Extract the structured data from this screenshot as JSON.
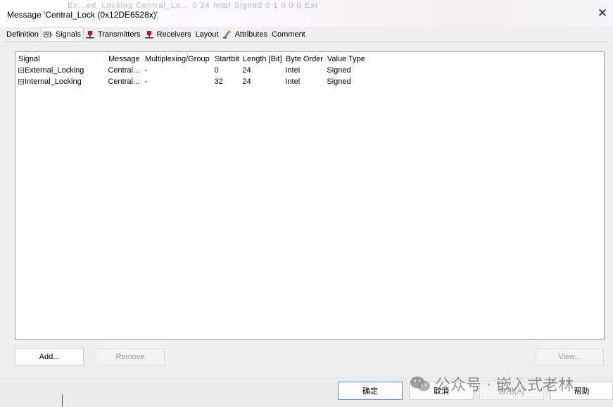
{
  "window": {
    "title": "Message 'Central_Lock (0x12DE6528x)'",
    "background_hint": "Ex...ed_Locking   Central_Lo...   0   24   Intel   Signed   0   1   0   0   0   Ext"
  },
  "tabs": [
    {
      "label": "Definition",
      "icon": "",
      "active": false
    },
    {
      "label": "Signals",
      "icon": "signal-icon",
      "active": true
    },
    {
      "label": "Transmitters",
      "icon": "transmitter-icon",
      "active": false
    },
    {
      "label": "Receivers",
      "icon": "receiver-icon",
      "active": false
    },
    {
      "label": "Layout",
      "icon": "",
      "active": false
    },
    {
      "label": "Attributes",
      "icon": "attributes-icon",
      "active": false
    },
    {
      "label": "Comment",
      "icon": "",
      "active": false
    }
  ],
  "signals_table": {
    "columns": [
      "Signal",
      "Message",
      "Multiplexing/Group",
      "Startbit",
      "Length [Bit]",
      "Byte Order",
      "Value Type"
    ],
    "rows": [
      [
        "External_Locking",
        "Central...",
        "-",
        "0",
        "24",
        "Intel",
        "Signed"
      ],
      [
        "Internal_Locking",
        "Central...",
        "-",
        "32",
        "24",
        "Intel",
        "Signed"
      ]
    ]
  },
  "buttons": {
    "add": "Add...",
    "remove": "Remove",
    "view": "View..."
  },
  "footer": {
    "ok": "确定",
    "cancel": "取消",
    "apply": "应用(A)",
    "help": "帮助"
  },
  "watermark": {
    "text": "公众号 · 嵌入式老林"
  },
  "colors": {
    "accent_border": "#5b8fd6",
    "tab_icon_red": "#c8102e"
  }
}
